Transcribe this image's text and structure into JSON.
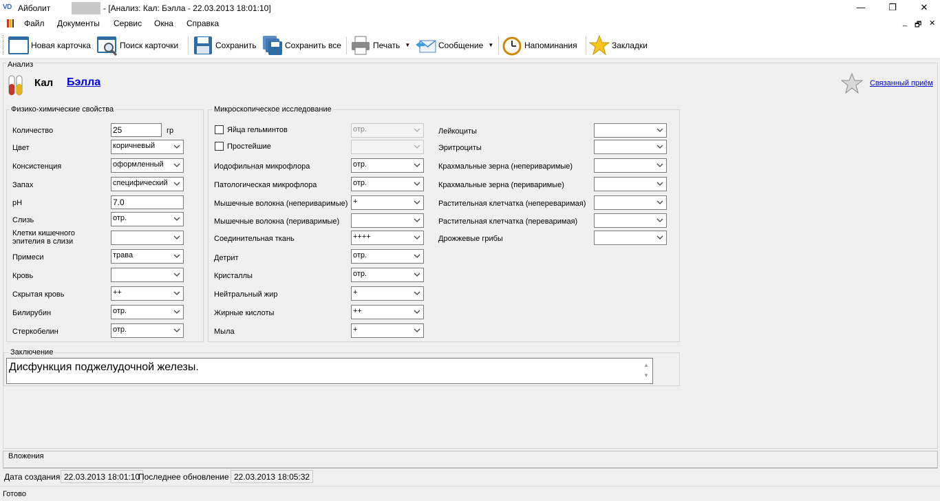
{
  "titlebar": {
    "logo": "VD",
    "app_name": "Айболит",
    "title": "- [Анализ: Кал: Бэлла - 22.03.2013 18:01:10]",
    "minimize": "—",
    "maximize": "❐",
    "close": "✕"
  },
  "menu": {
    "items": [
      "Файл",
      "Документы",
      "Сервис",
      "Окна",
      "Справка"
    ],
    "mdi": {
      "minimize": "_",
      "restore": "🗗",
      "close": "✕"
    }
  },
  "toolbar": {
    "new_card": "Новая карточка",
    "search_card": "Поиск карточки",
    "save": "Сохранить",
    "save_all": "Сохранить все",
    "print": "Печать",
    "message": "Сообщение",
    "reminders": "Напоминания",
    "bookmarks": "Закладки",
    "dropdown_arrow": "▼"
  },
  "analysis": {
    "group_title": "Анализ",
    "kind": "Кал",
    "patient": "Бэлла",
    "related_link": "Связанный приём",
    "icons": [
      "test-tube-icon",
      "star-icon"
    ]
  },
  "physchem": {
    "title": "Физико-химические свойства",
    "quantity": {
      "label": "Количество",
      "value": "25",
      "unit": "гр"
    },
    "color": {
      "label": "Цвет",
      "value": "коричневый"
    },
    "consistency": {
      "label": "Консистенция",
      "value": "оформленный"
    },
    "smell": {
      "label": "Запах",
      "value": "специфический"
    },
    "ph": {
      "label": "pH",
      "value": "7.0"
    },
    "mucus": {
      "label": "Слизь",
      "value": "отр."
    },
    "epithelium": {
      "label": "Клетки кишечного эпителия в слизи",
      "value": ""
    },
    "admixtures": {
      "label": "Примеси",
      "value": "трава"
    },
    "blood": {
      "label": "Кровь",
      "value": ""
    },
    "occult_blood": {
      "label": "Скрытая кровь",
      "value": "++"
    },
    "bilirubin": {
      "label": "Билирубин",
      "value": "отр."
    },
    "stercobilin": {
      "label": "Стеркобелин",
      "value": "отр."
    }
  },
  "micro": {
    "title": "Микроскопическое исследование",
    "col1": [
      {
        "label": "Яйца гельминтов",
        "value": "отр.",
        "checkbox": true,
        "disabled": true
      },
      {
        "label": "Простейшие",
        "value": "",
        "checkbox": true,
        "disabled": true
      },
      {
        "label": "Иодофильная микрофлора",
        "value": "отр."
      },
      {
        "label": "Патологическая микрофлора",
        "value": "отр."
      },
      {
        "label": "Мышечные волокна (непериваримые)",
        "value": "+"
      },
      {
        "label": "Мышечные волокна (периваримые)",
        "value": ""
      },
      {
        "label": "Соединительная ткань",
        "value": "++++"
      },
      {
        "label": "Детрит",
        "value": "отр."
      },
      {
        "label": "Кристаллы",
        "value": "отр."
      },
      {
        "label": "Нейтральный жир",
        "value": "+"
      },
      {
        "label": "Жирные кислоты",
        "value": "++"
      },
      {
        "label": "Мыла",
        "value": "+"
      }
    ],
    "col2": [
      {
        "label": "Лейкоциты",
        "value": ""
      },
      {
        "label": "Эритроциты",
        "value": ""
      },
      {
        "label": "Крахмальные зерна (непериваримые)",
        "value": ""
      },
      {
        "label": "Крахмальные зерна (периваримые)",
        "value": ""
      },
      {
        "label": "Растительная клетчатка (непереваримая)",
        "value": ""
      },
      {
        "label": "Растительная клетчатка (переваримая)",
        "value": ""
      },
      {
        "label": "Дрожжевые грибы",
        "value": ""
      }
    ]
  },
  "conclusion": {
    "title": "Заключение",
    "text": "Дисфункция поджелудочной железы.",
    "scroll_up": "▲",
    "scroll_down": "▼"
  },
  "attachments": {
    "title": "Вложения"
  },
  "info": {
    "created_label": "Дата создания",
    "created_value": "22.03.2013 18:01:10",
    "updated_label": "Последнее обновление",
    "updated_value": "22.03.2013 18:05:32"
  },
  "status": {
    "text": "Готово"
  },
  "colors": {
    "link": "#0000ee",
    "background": "#f0f0f0",
    "field_border": "#7a7a7a"
  }
}
